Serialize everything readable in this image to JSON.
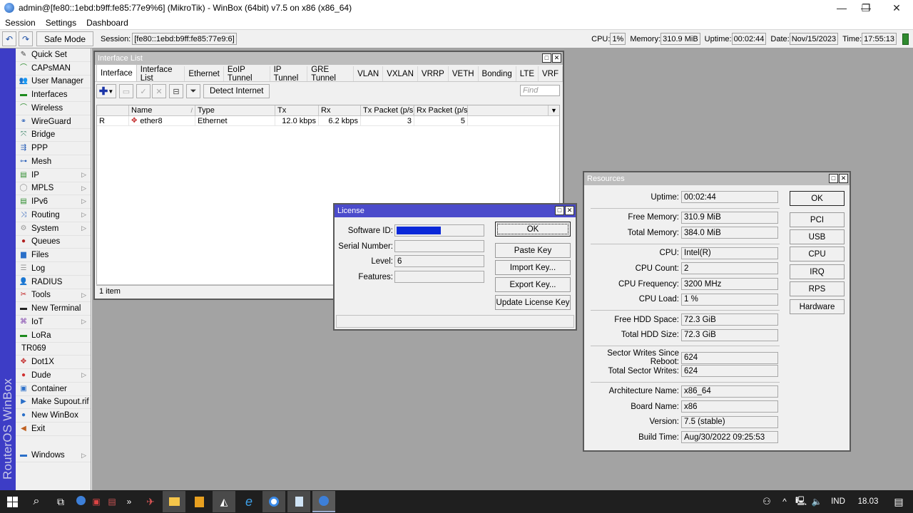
{
  "window": {
    "title": "admin@[fe80::1ebd:b9ff:fe85:77e9%6] (MikroTik) - WinBox (64bit) v7.5 on x86 (x86_64)",
    "minimize_icon": "—",
    "restore_icon": "❐",
    "close_icon": "✕"
  },
  "menu": [
    "Session",
    "Settings",
    "Dashboard"
  ],
  "toolbar": {
    "undo_icon": "↶",
    "redo_icon": "↷",
    "safe_mode_label": "Safe Mode",
    "session_label": "Session:",
    "session_value": "[fe80::1ebd:b9ff:fe85:77e9:6]",
    "cpu_label": "CPU:",
    "cpu_value": "1%",
    "memory_label": "Memory:",
    "memory_value": "310.9 MiB",
    "uptime_label": "Uptime:",
    "uptime_value": "00:02:44",
    "date_label": "Date:",
    "date_value": "Nov/15/2023",
    "time_label": "Time:",
    "time_value": "17:55:13"
  },
  "sidebar": {
    "brand": "RouterOS WinBox",
    "items": [
      {
        "label": "Quick Set",
        "icon": "wand-icon",
        "glyph": "✎",
        "color": "#444",
        "submenu": false
      },
      {
        "label": "CAPsMAN",
        "icon": "antenna-icon",
        "glyph": "⌒",
        "color": "#2a8a2a",
        "submenu": false
      },
      {
        "label": "User Manager",
        "icon": "users-icon",
        "glyph": "👥",
        "color": "#2a5fb8",
        "submenu": false
      },
      {
        "label": "Interfaces",
        "icon": "network-card-icon",
        "glyph": "▬",
        "color": "#1d8a1d",
        "submenu": false
      },
      {
        "label": "Wireless",
        "icon": "wireless-icon",
        "glyph": "⌒",
        "color": "#2a8a2a",
        "submenu": false
      },
      {
        "label": "WireGuard",
        "icon": "wireguard-icon",
        "glyph": "⚭",
        "color": "#2a5fb8",
        "submenu": false
      },
      {
        "label": "Bridge",
        "icon": "bridge-icon",
        "glyph": "⤧",
        "color": "#2a7a5a",
        "submenu": false
      },
      {
        "label": "PPP",
        "icon": "ppp-icon",
        "glyph": "⇶",
        "color": "#2a5fb8",
        "submenu": false
      },
      {
        "label": "Mesh",
        "icon": "mesh-icon",
        "glyph": "⊶",
        "color": "#2a5fb8",
        "submenu": false
      },
      {
        "label": "IP",
        "icon": "ip-icon",
        "glyph": "▤",
        "color": "#2a8a2a",
        "submenu": true
      },
      {
        "label": "MPLS",
        "icon": "mpls-icon",
        "glyph": "◯",
        "color": "#999",
        "submenu": true
      },
      {
        "label": "IPv6",
        "icon": "ipv6-icon",
        "glyph": "▤",
        "color": "#2a8a2a",
        "submenu": true
      },
      {
        "label": "Routing",
        "icon": "routing-icon",
        "glyph": "⤨",
        "color": "#2a5fb8",
        "submenu": true
      },
      {
        "label": "System",
        "icon": "gear-icon",
        "glyph": "⚙",
        "color": "#999",
        "submenu": true
      },
      {
        "label": "Queues",
        "icon": "queues-icon",
        "glyph": "●",
        "color": "#b02020",
        "submenu": false
      },
      {
        "label": "Files",
        "icon": "folder-icon",
        "glyph": "▆",
        "color": "#2a6fc8",
        "submenu": false
      },
      {
        "label": "Log",
        "icon": "log-icon",
        "glyph": "☰",
        "color": "#999",
        "submenu": false
      },
      {
        "label": "RADIUS",
        "icon": "radius-icon",
        "glyph": "👤",
        "color": "#2a5fb8",
        "submenu": false
      },
      {
        "label": "Tools",
        "icon": "tools-icon",
        "glyph": "✂",
        "color": "#c02020",
        "submenu": true
      },
      {
        "label": "New Terminal",
        "icon": "terminal-icon",
        "glyph": "▬",
        "color": "#222",
        "submenu": false
      },
      {
        "label": "IoT",
        "icon": "iot-icon",
        "glyph": "⌘",
        "color": "#7a3aa8",
        "submenu": true
      },
      {
        "label": "LoRa",
        "icon": "lora-icon",
        "glyph": "▬",
        "color": "#1d8a1d",
        "submenu": false
      },
      {
        "label": "TR069",
        "icon": "",
        "glyph": "",
        "color": "#000",
        "submenu": false
      },
      {
        "label": "Dot1X",
        "icon": "dot1x-icon",
        "glyph": "✥",
        "color": "#c02020",
        "submenu": false
      },
      {
        "label": "Dude",
        "icon": "dude-icon",
        "glyph": "●",
        "color": "#d03030",
        "submenu": true
      },
      {
        "label": "Container",
        "icon": "container-icon",
        "glyph": "▣",
        "color": "#2a6fc8",
        "submenu": false
      },
      {
        "label": "Make Supout.rif",
        "icon": "supout-icon",
        "glyph": "▶",
        "color": "#2a6fc8",
        "submenu": false
      },
      {
        "label": "New WinBox",
        "icon": "winbox-icon",
        "glyph": "●",
        "color": "#2a6fc8",
        "submenu": false
      },
      {
        "label": "Exit",
        "icon": "exit-icon",
        "glyph": "◀",
        "color": "#c06020",
        "submenu": false
      }
    ],
    "windows_item": {
      "label": "Windows",
      "icon": "windows-icon",
      "glyph": "▬",
      "color": "#2a6fc8",
      "submenu": true
    }
  },
  "interface_window": {
    "title": "Interface List",
    "tabs": [
      "Interface",
      "Interface List",
      "Ethernet",
      "EoIP Tunnel",
      "IP Tunnel",
      "GRE Tunnel",
      "VLAN",
      "VXLAN",
      "VRRP",
      "VETH",
      "Bonding",
      "LTE",
      "VRF"
    ],
    "active_tab": "Interface",
    "detect_internet_label": "Detect Internet",
    "find_placeholder": "Find",
    "columns": [
      "",
      "Name",
      "Type",
      "Tx",
      "Rx",
      "Tx Packet (p/s)",
      "Rx Packet (p/s)",
      ""
    ],
    "rows": [
      {
        "flag": "R",
        "name": "ether8",
        "type": "Ethernet",
        "tx": "12.0 kbps",
        "rx": "6.2 kbps",
        "tx_packet": "3",
        "rx_packet": "5"
      }
    ],
    "item_count": "1 item"
  },
  "license_window": {
    "title": "License",
    "fields": [
      {
        "label": "Software ID:",
        "value": "",
        "redacted": true
      },
      {
        "label": "Serial Number:",
        "value": ""
      },
      {
        "label": "Level:",
        "value": "6"
      },
      {
        "label": "Features:",
        "value": ""
      }
    ],
    "buttons": [
      "OK",
      "Paste Key",
      "Import Key...",
      "Export Key...",
      "Update License Key"
    ]
  },
  "resources_window": {
    "title": "Resources",
    "groups": [
      [
        {
          "label": "Uptime:",
          "value": "00:02:44"
        }
      ],
      [
        {
          "label": "Free Memory:",
          "value": "310.9 MiB"
        },
        {
          "label": "Total Memory:",
          "value": "384.0 MiB"
        }
      ],
      [
        {
          "label": "CPU:",
          "value": "Intel(R)"
        },
        {
          "label": "CPU Count:",
          "value": "2"
        },
        {
          "label": "CPU Frequency:",
          "value": "3200 MHz"
        },
        {
          "label": "CPU Load:",
          "value": "1 %"
        }
      ],
      [
        {
          "label": "Free HDD Space:",
          "value": "72.3 GiB"
        },
        {
          "label": "Total HDD Size:",
          "value": "72.3 GiB"
        }
      ],
      [
        {
          "label": "Sector Writes Since Reboot:",
          "value": "624"
        },
        {
          "label": "Total Sector Writes:",
          "value": "624"
        }
      ],
      [
        {
          "label": "Architecture Name:",
          "value": "x86_64"
        },
        {
          "label": "Board Name:",
          "value": "x86"
        },
        {
          "label": "Version:",
          "value": "7.5 (stable)"
        },
        {
          "label": "Build Time:",
          "value": "Aug/30/2022 09:25:53"
        }
      ]
    ],
    "buttons": [
      "OK",
      "PCI",
      "USB",
      "CPU",
      "IRQ",
      "RPS",
      "Hardware"
    ]
  },
  "taskbar": {
    "language": "IND",
    "clock": "18.03",
    "colors": {
      "background": "#1f1f1f",
      "active_tile": "#4a4a4a"
    }
  }
}
